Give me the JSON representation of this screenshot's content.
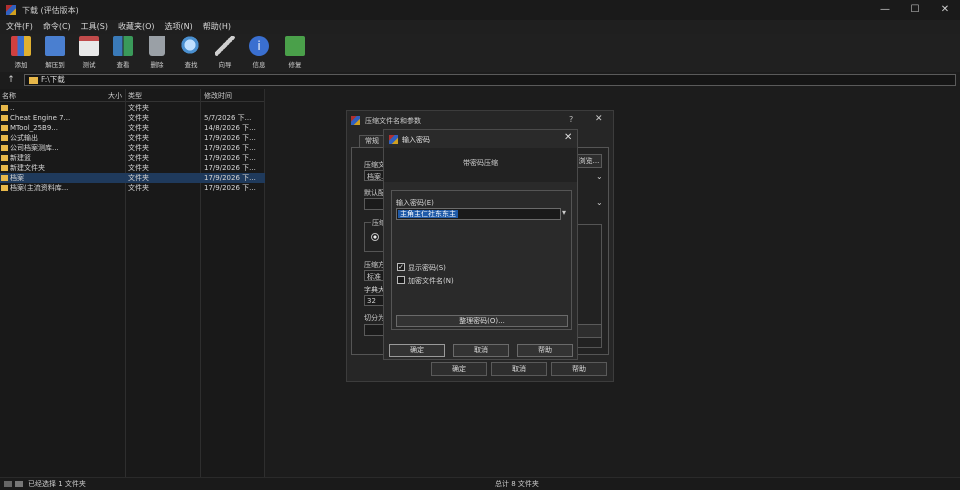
{
  "window": {
    "title": "下载 (评估版本)",
    "min": "—",
    "max": "☐",
    "close": "✕"
  },
  "menu": [
    "文件(F)",
    "命令(C)",
    "工具(S)",
    "收藏夹(O)",
    "选项(N)",
    "帮助(H)"
  ],
  "toolbar": [
    {
      "label": "添加",
      "color": "#d04040"
    },
    {
      "label": "解压到",
      "color": "#4a7fd0"
    },
    {
      "label": "测试",
      "color": "#c04a4a"
    },
    {
      "label": "查看",
      "color": "#3a7ab8"
    },
    {
      "label": "删除",
      "color": "#9aa0a6"
    },
    {
      "label": "查找",
      "color": "#4a90d0"
    },
    {
      "label": "向导",
      "color": "#8a6fd0"
    },
    {
      "label": "信息",
      "color": "#3a6fd0"
    },
    {
      "label": "修复",
      "color": "#4aa04a"
    }
  ],
  "address": {
    "up": "↑",
    "path": "F:\\下载"
  },
  "filelist": {
    "headers": {
      "name": "名称",
      "size": "大小",
      "type": "类型",
      "date": "修改时间"
    },
    "rows": [
      {
        "name": "..",
        "type": "文件夹",
        "date": ""
      },
      {
        "name": "Cheat Engine 7...",
        "type": "文件夹",
        "date": "5/7/2026 下..."
      },
      {
        "name": "MTool_25B9...",
        "type": "文件夹",
        "date": "14/8/2026 下..."
      },
      {
        "name": "公式输出",
        "type": "文件夹",
        "date": "17/9/2026 下..."
      },
      {
        "name": "公司档案测库...",
        "type": "文件夹",
        "date": "17/9/2026 下..."
      },
      {
        "name": "新建篮",
        "type": "文件夹",
        "date": "17/9/2026 下..."
      },
      {
        "name": "新建文件夹",
        "type": "文件夹",
        "date": "17/9/2026 下..."
      },
      {
        "name": "档案",
        "type": "文件夹",
        "date": "17/9/2026 下...",
        "selected": true
      },
      {
        "name": "档案(主流资料库...",
        "type": "文件夹",
        "date": "17/9/2026 下..."
      }
    ]
  },
  "status": {
    "left": "已经选择 1 文件夹",
    "right": "总计 8 文件夹"
  },
  "dialog_back": {
    "title": "压缩文件名和参数",
    "help": "?",
    "close": "✕",
    "tab": "常规",
    "lbl1": "压缩文",
    "box1": "档案.r",
    "browse": "浏览...",
    "lbl2": "默认配",
    "lbl3": "压缩",
    "lbl4": "压缩方",
    "box4": "标准",
    "lbl5": "字典大",
    "box5": "32",
    "lbl6": "切分为",
    "ok": "确定",
    "cancel": "取消",
    "help_btn": "帮助"
  },
  "dialog_front": {
    "title": "输入密码",
    "close": "✕",
    "heading": "带密码压缩",
    "input_label": "输入密码(E)",
    "input_value": "主角主仁社东东主",
    "dropdown": "▾",
    "show_password": "显示密码(S)",
    "show_checked": "✓",
    "encrypt_names": "加密文件名(N)",
    "manage": "整理密码(O)...",
    "ok": "确定",
    "cancel": "取消",
    "help": "帮助"
  }
}
